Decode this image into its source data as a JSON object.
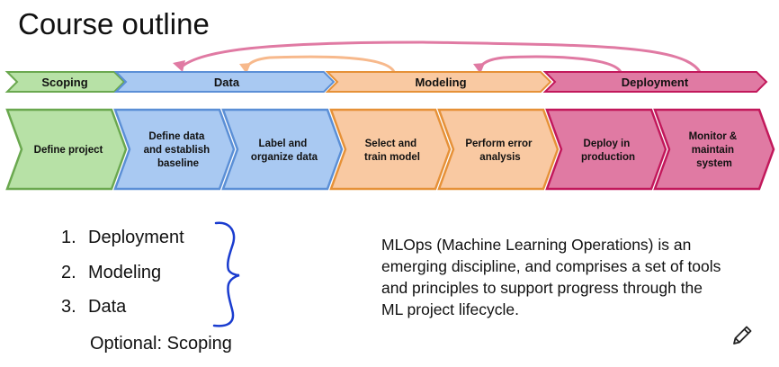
{
  "title": "Course outline",
  "colors": {
    "scoping_fill": "#b7e1a6",
    "scoping_stroke": "#6aa84f",
    "data_fill": "#a9c9f2",
    "data_stroke": "#5b8fd6",
    "modeling_fill": "#f9c9a2",
    "modeling_stroke": "#e69138",
    "deployment_fill": "#e07aa3",
    "deployment_stroke": "#c2185b",
    "brace": "#1a3ccf"
  },
  "phases": [
    {
      "label": "Scoping"
    },
    {
      "label": "Data"
    },
    {
      "label": "Modeling"
    },
    {
      "label": "Deployment"
    }
  ],
  "steps": [
    {
      "lines": [
        "Define project"
      ]
    },
    {
      "lines": [
        "Define data",
        "and establish",
        "baseline"
      ]
    },
    {
      "lines": [
        "Label and",
        "organize data"
      ]
    },
    {
      "lines": [
        "Select and",
        "train model"
      ]
    },
    {
      "lines": [
        "Perform error",
        "analysis"
      ]
    },
    {
      "lines": [
        "Deploy in",
        "production"
      ]
    },
    {
      "lines": [
        "Monitor &",
        "maintain",
        "system"
      ]
    }
  ],
  "outline": {
    "items": [
      {
        "num": "1.",
        "label": "Deployment"
      },
      {
        "num": "2.",
        "label": "Modeling"
      },
      {
        "num": "3.",
        "label": "Data"
      }
    ],
    "optional": "Optional: Scoping"
  },
  "mlops_text": "MLOps (Machine Learning Operations) is an emerging discipline, and comprises a set of tools and principles to support progress through the ML project lifecycle.",
  "icons": {
    "pencil": "pencil-icon",
    "brace": "curly-brace-icon"
  }
}
